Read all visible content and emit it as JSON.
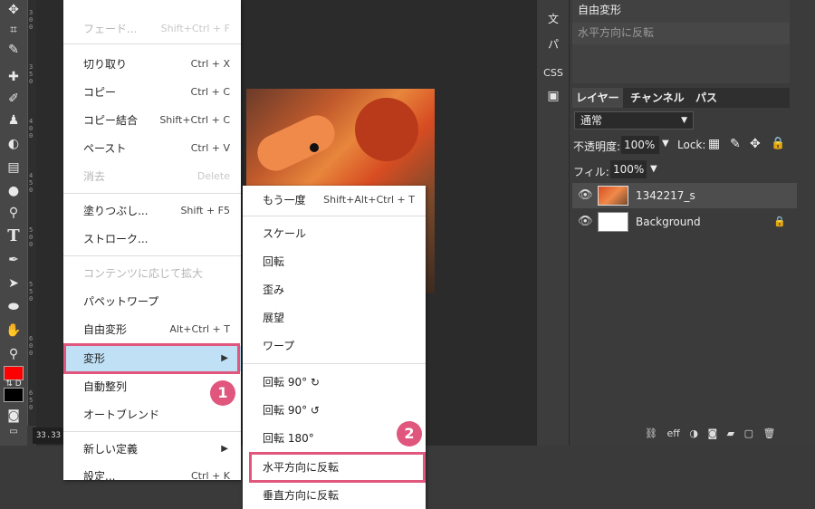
{
  "toolbar": {
    "icons": [
      "move-icon",
      "crop-icon",
      "eyedropper-icon",
      "heal-icon",
      "brush-icon",
      "stamp-icon",
      "eraser-icon",
      "gradient-icon",
      "blur-icon",
      "dodge-icon",
      "type-icon",
      "pen-icon",
      "path-select-icon",
      "shape-icon",
      "hand-icon",
      "zoom-icon"
    ],
    "type_glyph": "T",
    "swap_label": "⇅ D",
    "colors": {
      "foreground": "#ff0000",
      "background": "#000000"
    }
  },
  "ruler": {
    "labels": [
      "300",
      "350",
      "400",
      "450",
      "500",
      "550",
      "600",
      "650"
    ]
  },
  "canvas": {
    "zoom_text": "33.33"
  },
  "edit_menu": {
    "items": [
      {
        "label": "フェード...",
        "shortcut": "Shift+Ctrl + F",
        "disabled": true
      },
      {
        "label": "切り取り",
        "shortcut": "Ctrl + X"
      },
      {
        "label": "コピー",
        "shortcut": "Ctrl + C"
      },
      {
        "label": "コピー結合",
        "shortcut": "Shift+Ctrl + C"
      },
      {
        "label": "ペースト",
        "shortcut": "Ctrl + V"
      },
      {
        "label": "消去",
        "shortcut": "Delete",
        "disabled": true
      },
      {
        "label": "塗りつぶし...",
        "shortcut": "Shift + F5"
      },
      {
        "label": "ストローク..."
      },
      {
        "label": "コンテンツに応じて拡大",
        "disabled": true
      },
      {
        "label": "パペットワープ"
      },
      {
        "label": "自由変形",
        "shortcut": "Alt+Ctrl + T"
      },
      {
        "label": "変形",
        "submenu": true,
        "active": true
      },
      {
        "label": "自動整列"
      },
      {
        "label": "オートブレンド"
      },
      {
        "label": "新しい定義",
        "submenu": true
      },
      {
        "label": "設定...",
        "shortcut": "Ctrl + K"
      }
    ]
  },
  "transform_submenu": {
    "items": [
      {
        "label": "もう一度",
        "shortcut": "Shift+Alt+Ctrl + T"
      },
      {
        "label": "スケール"
      },
      {
        "label": "回転"
      },
      {
        "label": "歪み"
      },
      {
        "label": "展望"
      },
      {
        "label": "ワープ"
      },
      {
        "label": "回転 90° ↻"
      },
      {
        "label": "回転 90° ↺"
      },
      {
        "label": "回転 180°"
      },
      {
        "label": "水平方向に反転",
        "highlighted": true
      },
      {
        "label": "垂直方向に反転"
      }
    ]
  },
  "annotations": {
    "badge1": "1",
    "badge2": "2",
    "color": "#e0567d"
  },
  "side_strip": {
    "items": [
      "文",
      "パ",
      "CSS"
    ]
  },
  "history": {
    "items": [
      "自由変形",
      "水平方向に反転"
    ]
  },
  "layers_panel": {
    "tabs": [
      "レイヤー",
      "チャンネル",
      "パス"
    ],
    "blend_mode": "通常",
    "opacity_label": "不透明度:",
    "opacity_value": "100%",
    "lock_label": "Lock:",
    "fill_label": "フィル:",
    "fill_value": "100%",
    "layers": [
      {
        "name": "1342217_s",
        "selected": true
      },
      {
        "name": "Background",
        "locked": true
      }
    ],
    "footer": [
      "link-icon",
      "eff",
      "adjust-icon",
      "mask-icon",
      "folder-icon",
      "new-layer-icon",
      "trash-icon"
    ],
    "footer_eff_label": "eff"
  }
}
